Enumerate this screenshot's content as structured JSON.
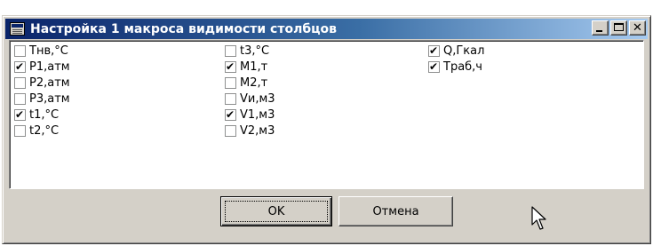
{
  "window": {
    "title": "Настройка 1 макроса видимости столбцов",
    "controls": {
      "minimize": "_",
      "maximize": "□",
      "close": "×"
    }
  },
  "columns": [
    [
      {
        "label": "Тнв,°С",
        "checked": false
      },
      {
        "label": "P1,атм",
        "checked": true
      },
      {
        "label": "P2,атм",
        "checked": false
      },
      {
        "label": "P3,атм",
        "checked": false
      },
      {
        "label": "t1,°C",
        "checked": true
      },
      {
        "label": "t2,°C",
        "checked": false
      }
    ],
    [
      {
        "label": "t3,°C",
        "checked": false
      },
      {
        "label": "M1,т",
        "checked": true
      },
      {
        "label": "M2,т",
        "checked": false
      },
      {
        "label": "Vи,м3",
        "checked": false
      },
      {
        "label": "V1,м3",
        "checked": true
      },
      {
        "label": "V2,м3",
        "checked": false
      }
    ],
    [
      {
        "label": "Q,Гкал",
        "checked": true
      },
      {
        "label": "Траб,ч",
        "checked": true
      }
    ]
  ],
  "buttons": {
    "ok_label": "OK",
    "cancel_label": "Отмена"
  },
  "colors": {
    "title_gradient_start": "#0a246a",
    "title_gradient_end": "#a6caf0",
    "dialog_face": "#d4d0c8"
  }
}
